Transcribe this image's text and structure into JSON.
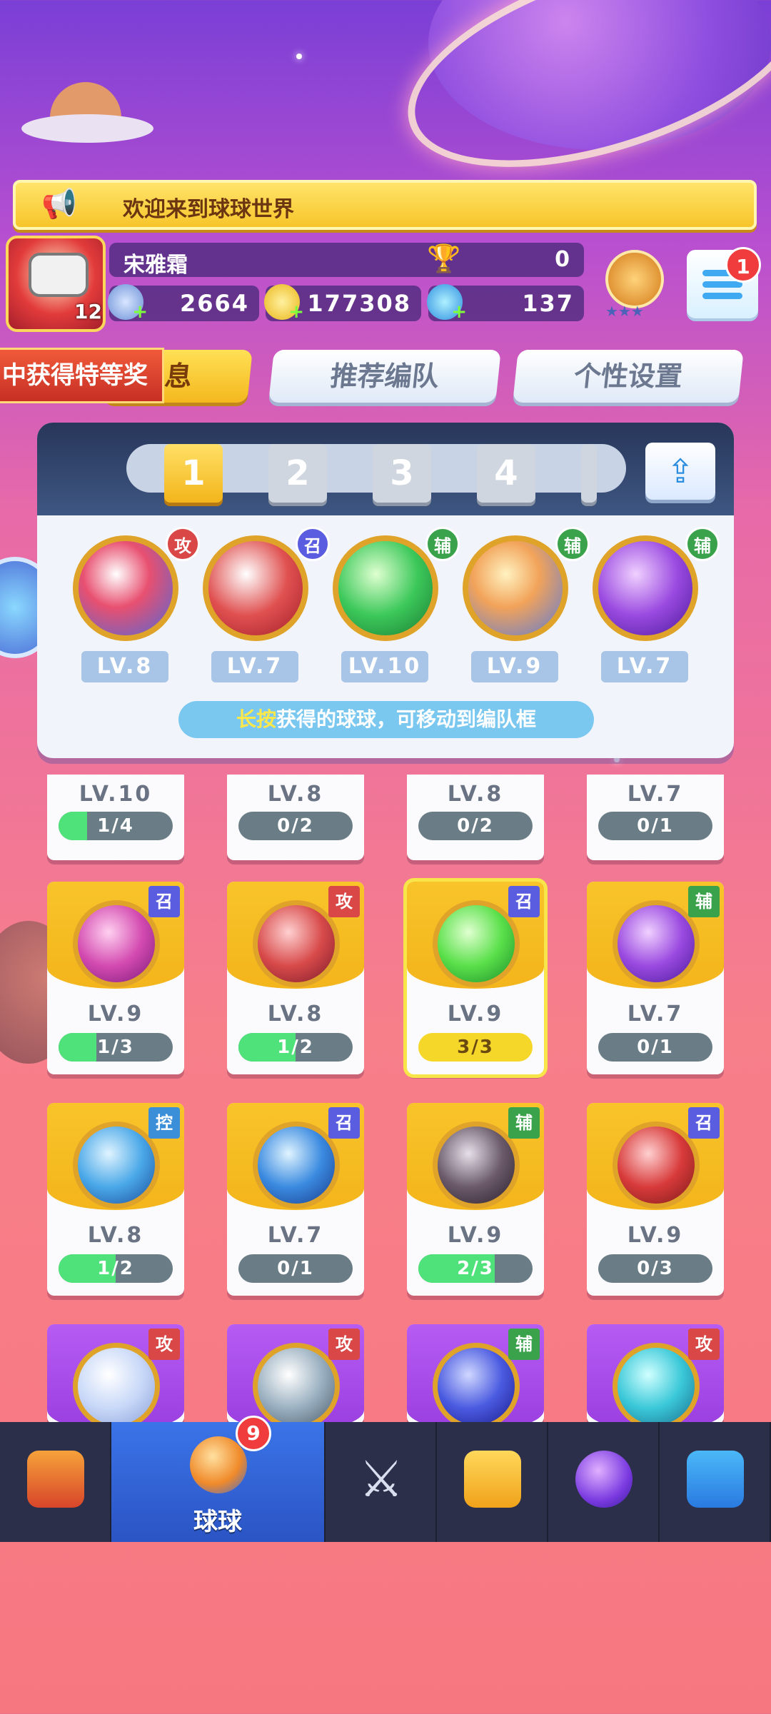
{
  "banner": {
    "text": "欢迎来到球球世界",
    "icon": "megaphone-icon"
  },
  "player": {
    "level": "12",
    "name": "宋雅霜",
    "trophies": "0",
    "energy": "2664",
    "coins": "177308",
    "gems": "137",
    "menu_notifications": "1"
  },
  "ribbon": {
    "text": "中获得特等奖"
  },
  "tabs": [
    {
      "label": "息",
      "active": true
    },
    {
      "label": "推荐编队",
      "active": false
    },
    {
      "label": "个性设置",
      "active": false
    }
  ],
  "team": {
    "slots": [
      "1",
      "2",
      "3",
      "4"
    ],
    "active_slot": "1",
    "balls": [
      {
        "tag": "攻",
        "type": "atk",
        "level": "LV.8",
        "icon": "prism-ball-icon"
      },
      {
        "tag": "召",
        "type": "sum",
        "level": "LV.7",
        "icon": "robot-ball-icon"
      },
      {
        "tag": "辅",
        "type": "sup",
        "level": "LV.10",
        "icon": "arrow-star-ball-icon"
      },
      {
        "tag": "辅",
        "type": "sup",
        "level": "LV.9",
        "icon": "people-ball-icon"
      },
      {
        "tag": "辅",
        "type": "sup",
        "level": "LV.7",
        "icon": "leaf-ball-icon"
      }
    ],
    "hint_highlight": "长按",
    "hint_text": "获得的球球，可移动到编队框"
  },
  "inventory": {
    "row0": [
      {
        "level": "LV.10",
        "progress": "1/4",
        "fraction": 0.25
      },
      {
        "level": "LV.8",
        "progress": "0/2",
        "fraction": 0
      },
      {
        "level": "LV.8",
        "progress": "0/2",
        "fraction": 0
      },
      {
        "level": "LV.7",
        "progress": "0/1",
        "fraction": 0
      }
    ],
    "row1": [
      {
        "tag": "召",
        "type": "sum",
        "level": "LV.9",
        "progress": "1/3",
        "fraction": 0.33,
        "icon": "feather-ball-icon"
      },
      {
        "tag": "攻",
        "type": "atk",
        "level": "LV.8",
        "progress": "1/2",
        "fraction": 0.5,
        "icon": "fist-ball-icon"
      },
      {
        "tag": "召",
        "type": "sum",
        "level": "LV.9",
        "progress": "3/3",
        "fraction": 1,
        "icon": "star-ball-icon"
      },
      {
        "tag": "辅",
        "type": "sup",
        "level": "LV.7",
        "progress": "0/1",
        "fraction": 0,
        "icon": "leaf-ball-icon"
      }
    ],
    "row2": [
      {
        "tag": "控",
        "type": "ctl",
        "level": "LV.8",
        "progress": "1/2",
        "fraction": 0.5,
        "icon": "snowflake-ball-icon"
      },
      {
        "tag": "召",
        "type": "sum",
        "level": "LV.7",
        "progress": "0/1",
        "fraction": 0,
        "icon": "ice-ball-icon"
      },
      {
        "tag": "辅",
        "type": "sup",
        "level": "LV.9",
        "progress": "2/3",
        "fraction": 0.67,
        "icon": "skull-ball-icon"
      },
      {
        "tag": "召",
        "type": "sum",
        "level": "LV.9",
        "progress": "0/3",
        "fraction": 0,
        "icon": "cannon-ball-icon"
      }
    ],
    "row3": [
      {
        "tag": "攻",
        "type": "atk",
        "icon": "bubble-ball-icon"
      },
      {
        "tag": "攻",
        "type": "atk",
        "icon": "fan-ball-icon"
      },
      {
        "tag": "辅",
        "type": "sup",
        "icon": "swap-ball-icon"
      },
      {
        "tag": "攻",
        "type": "atk",
        "icon": "vortex-ball-icon"
      }
    ]
  },
  "nav": {
    "active_label": "球球",
    "badge": "9",
    "items": [
      "shop-icon",
      "ball-icon",
      "swords-icon",
      "whistle-icon",
      "planet-icon",
      "chat-heart-icon"
    ]
  }
}
